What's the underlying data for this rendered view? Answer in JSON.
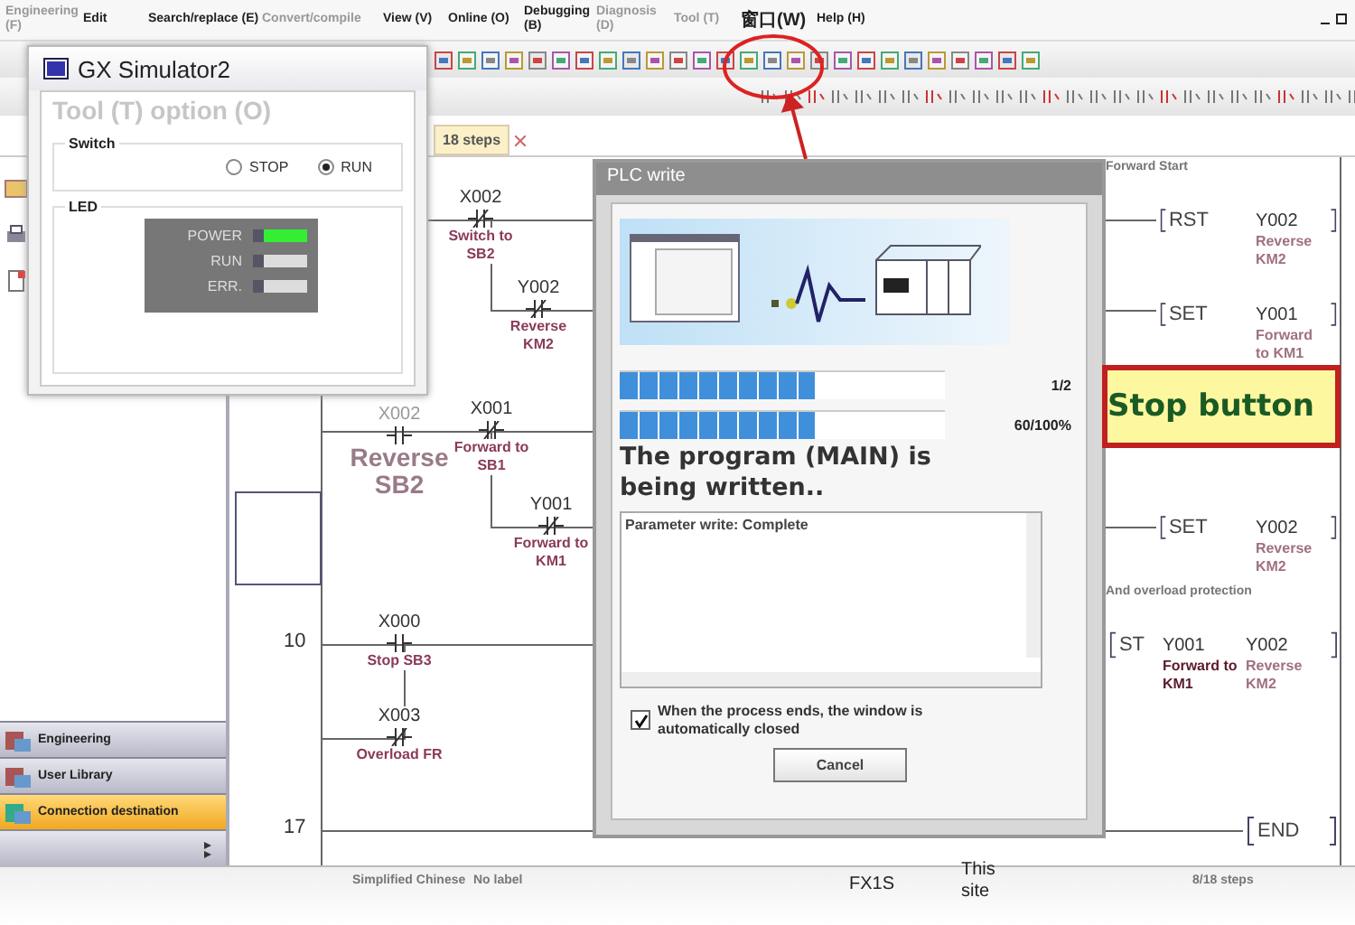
{
  "menu": [
    {
      "label": "Engineering (F)",
      "disabled": true
    },
    {
      "label": "Edit",
      "disabled": false
    },
    {
      "label": "Search/replace (E)",
      "disabled": false
    },
    {
      "label": "Convert/compile",
      "disabled": true
    },
    {
      "label": "View (V)",
      "disabled": false
    },
    {
      "label": "Online (O)",
      "disabled": false
    },
    {
      "label": "Debugging (B)",
      "disabled": false
    },
    {
      "label": "Diagnosis (D)",
      "disabled": true
    },
    {
      "label": "Tool (T)",
      "disabled": true
    },
    {
      "label": "窗口(W)",
      "disabled": false
    },
    {
      "label": "Help (H)",
      "disabled": false
    }
  ],
  "tab": {
    "label": "18 steps"
  },
  "nav": {
    "items": [
      {
        "label": "Engineering",
        "selected": false
      },
      {
        "label": "User Library",
        "selected": false
      },
      {
        "label": "Connection destination",
        "selected": true
      }
    ]
  },
  "ladder": {
    "statements": [
      {
        "text": "Forward Start"
      },
      {
        "text": "And overload protection"
      }
    ],
    "line_numbers": [
      "10",
      "17"
    ],
    "contacts": [
      {
        "kind": "nc",
        "device": "X002",
        "comment": "Switch to SB2"
      },
      {
        "kind": "nc",
        "device": "Y002",
        "comment": "Reverse KM2"
      },
      {
        "kind": "no",
        "device": "X002",
        "comment": "Reverse SB2"
      },
      {
        "kind": "nc",
        "device": "X001",
        "comment": "Forward to SB1"
      },
      {
        "kind": "nc",
        "device": "Y001",
        "comment": "Forward to KM1"
      },
      {
        "kind": "no",
        "device": "X000",
        "comment": "Stop SB3"
      },
      {
        "kind": "nc",
        "device": "X003",
        "comment": "Overload FR"
      }
    ],
    "instructions": [
      {
        "op": "RST",
        "operands": [
          {
            "device": "Y002",
            "comment": "Reverse KM2"
          }
        ]
      },
      {
        "op": "SET",
        "operands": [
          {
            "device": "Y001",
            "comment": "Forward to KM1"
          }
        ]
      },
      {
        "op": "SET",
        "operands": [
          {
            "device": "Y002",
            "comment": "Reverse KM2"
          }
        ]
      },
      {
        "op": "ST",
        "operands": [
          {
            "device": "Y001",
            "comment": "Forward to KM1"
          },
          {
            "device": "Y002",
            "comment": "Reverse KM2"
          }
        ]
      },
      {
        "op": "END"
      }
    ]
  },
  "simulator": {
    "title": "GX Simulator2",
    "menu_text": "Tool (T) option (O)",
    "switch": {
      "label": "Switch",
      "options": [
        {
          "label": "STOP",
          "selected": false
        },
        {
          "label": "RUN",
          "selected": true
        }
      ]
    },
    "led": {
      "label": "LED",
      "lamps": [
        {
          "label": "POWER",
          "on": true
        },
        {
          "label": "RUN",
          "on": false
        },
        {
          "label": "ERR.",
          "on": false
        }
      ]
    }
  },
  "dialog": {
    "title": "PLC write",
    "bars": [
      {
        "level": 0.6,
        "reading": "1/2"
      },
      {
        "level": 0.6,
        "reading": "60/100%"
      }
    ],
    "message": "The program (MAIN) is being written..",
    "log": "Parameter write: Complete",
    "auto_close": {
      "label": "When the process ends, the window is automatically closed",
      "checked": true
    },
    "cancel": "Cancel"
  },
  "callout": {
    "text": "Stop button"
  },
  "status_bar": [
    "Simplified Chinese",
    "No label",
    "FX1S",
    "This site",
    "8/18 steps"
  ]
}
